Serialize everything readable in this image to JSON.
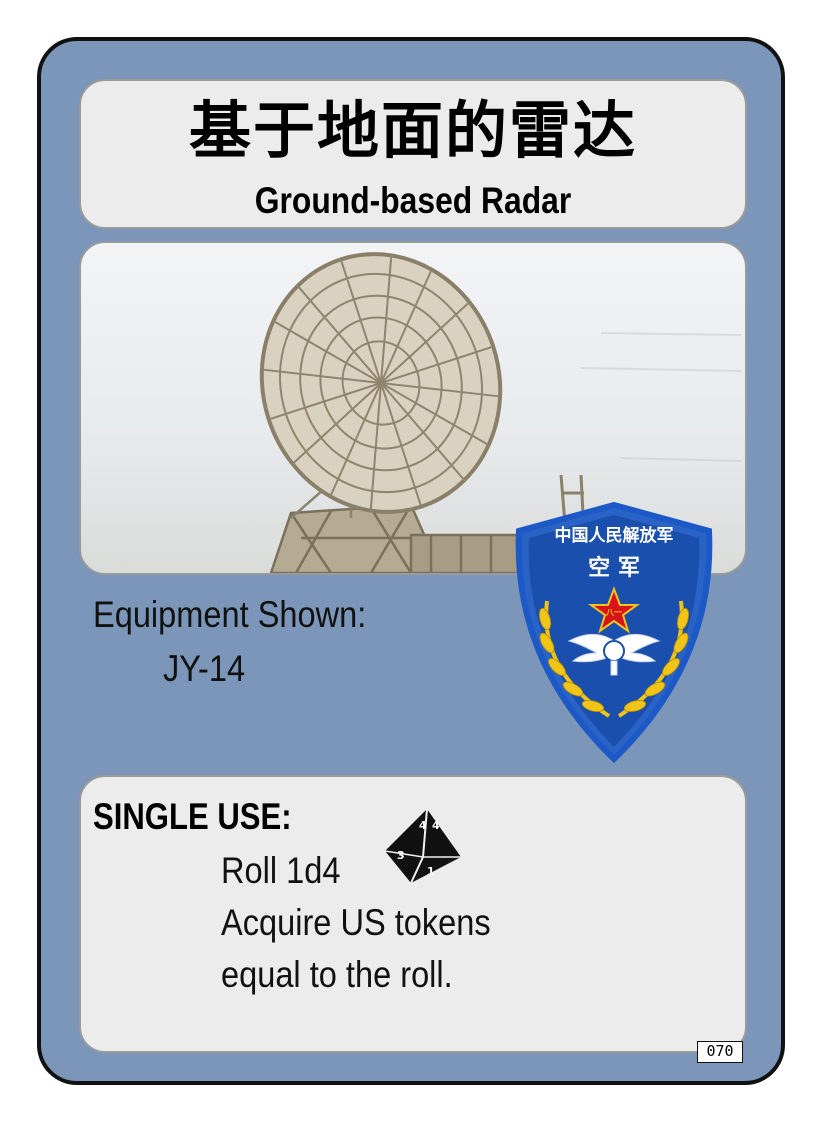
{
  "card": {
    "title_zh": "基于地面的雷达",
    "title_en": "Ground-based Radar",
    "equipment_label": "Equipment Shown:",
    "equipment_value": "JY-14",
    "rules": {
      "heading": "SINGLE USE:",
      "lines": [
        "Roll 1d4",
        "Acquire US tokens",
        "equal to the roll."
      ]
    },
    "card_number": "070"
  },
  "patch": {
    "arc_text": "中国人民解放军",
    "branch_text": "空  军",
    "star_text": "八一"
  },
  "die": {
    "faces": [
      "4",
      "4",
      "1",
      "3"
    ]
  },
  "colors": {
    "card_bg": "#7b96b8",
    "panel_bg": "#ececec",
    "patch_blue": "#1b4fae",
    "patch_gold": "#f0c419",
    "star_red": "#d7141a"
  },
  "icons": [
    "radar-dish-image",
    "plaaf-patch-icon",
    "d4-die-icon"
  ]
}
